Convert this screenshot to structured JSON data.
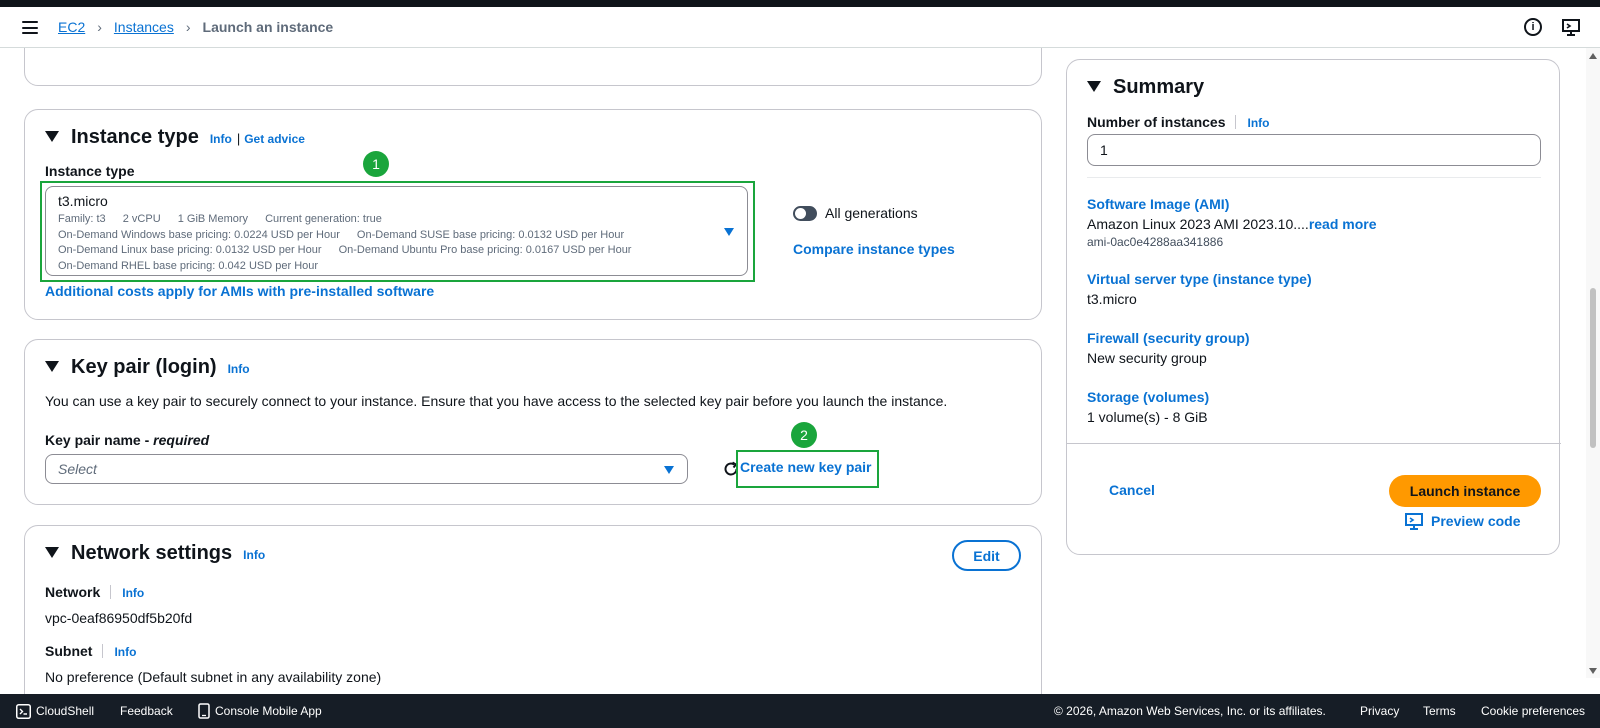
{
  "breadcrumb": {
    "ec2": "EC2",
    "instances": "Instances",
    "current": "Launch an instance"
  },
  "instance_type": {
    "title": "Instance type",
    "info": "Info",
    "get_advice": "Get advice",
    "field_label": "Instance type",
    "value": "t3.micro",
    "details": {
      "family": "Family: t3",
      "vcpu": "2 vCPU",
      "memory": "1 GiB Memory",
      "generation": "Current generation: true",
      "windows": "On-Demand Windows base pricing: 0.0224 USD per Hour",
      "suse": "On-Demand SUSE base pricing: 0.0132 USD per Hour",
      "linux": "On-Demand Linux base pricing: 0.0132 USD per Hour",
      "ubuntu": "On-Demand Ubuntu Pro base pricing: 0.0167 USD per Hour",
      "rhel": "On-Demand RHEL base pricing: 0.042 USD per Hour"
    },
    "all_generations": "All generations",
    "compare": "Compare instance types",
    "additional_costs": "Additional costs apply for AMIs with pre-installed software",
    "badge": "1"
  },
  "key_pair": {
    "title": "Key pair (login)",
    "info": "Info",
    "description": "You can use a key pair to securely connect to your instance. Ensure that you have access to the selected key pair before you launch the instance.",
    "field_label": "Key pair name",
    "required": "required",
    "placeholder": "Select",
    "create": "Create new key pair",
    "badge": "2"
  },
  "network": {
    "title": "Network settings",
    "info": "Info",
    "edit": "Edit",
    "network_label": "Network",
    "network_info": "Info",
    "network_value": "vpc-0eaf86950df5b20fd",
    "subnet_label": "Subnet",
    "subnet_info": "Info",
    "subnet_value": "No preference (Default subnet in any availability zone)"
  },
  "summary": {
    "title": "Summary",
    "num_label": "Number of instances",
    "num_info": "Info",
    "num_value": "1",
    "ami_label": "Software Image (AMI)",
    "ami_value": "Amazon Linux 2023 AMI 2023.10....",
    "ami_read_more": "read more",
    "ami_id": "ami-0ac0e4288aa341886",
    "vst_label": "Virtual server type (instance type)",
    "vst_value": "t3.micro",
    "fw_label": "Firewall (security group)",
    "fw_value": "New security group",
    "storage_label": "Storage (volumes)",
    "storage_value": "1 volume(s) - 8 GiB",
    "cancel": "Cancel",
    "launch": "Launch instance",
    "preview": "Preview code"
  },
  "footer": {
    "cloudshell": "CloudShell",
    "feedback": "Feedback",
    "mobile": "Console Mobile App",
    "copyright": "© 2026, Amazon Web Services, Inc. or its affiliates.",
    "privacy": "Privacy",
    "terms": "Terms",
    "cookies": "Cookie preferences"
  },
  "colors": {
    "accent": "#0972d3",
    "launch": "#ff9900",
    "highlight": "#1aa53c",
    "footer": "#161d26"
  }
}
